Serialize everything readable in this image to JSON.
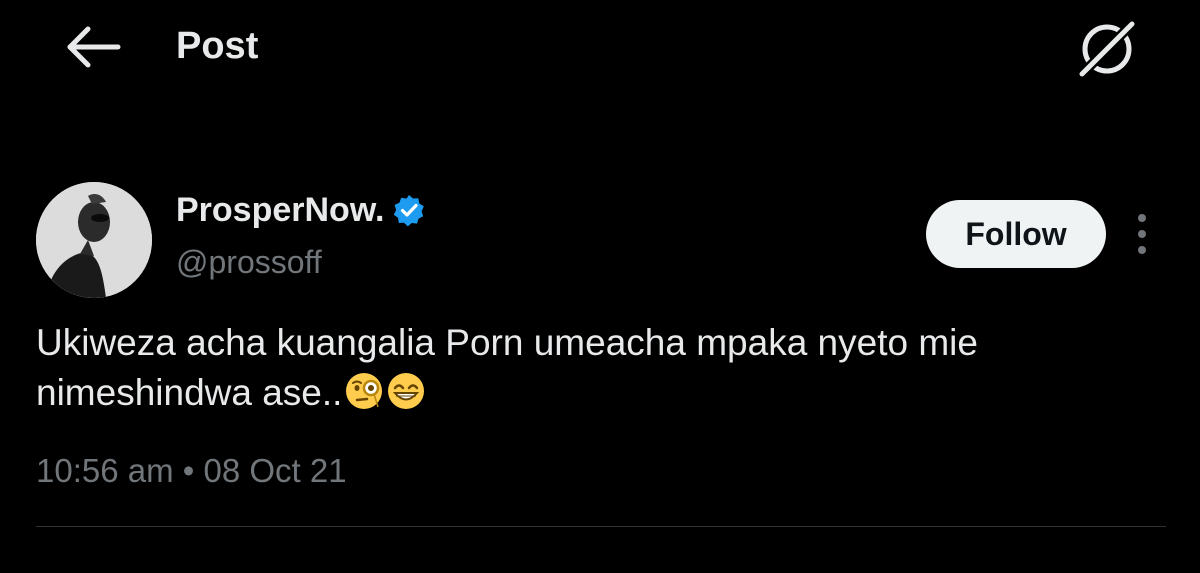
{
  "header": {
    "title": "Post",
    "back_icon": "arrow-left-icon",
    "grok_icon": "grok-slash-icon"
  },
  "post": {
    "author": {
      "name": "ProsperNow.",
      "handle": "@prossoff",
      "verified": true,
      "verified_color": "#1d9bf0"
    },
    "follow_label": "Follow",
    "more_icon": "more-vertical-icon",
    "text": "Ukiweza acha kuangalia Porn umeacha mpaka nyeto mie nimeshindwa ase..",
    "emojis": [
      "face-with-monocle",
      "beaming-face-with-smiling-eyes"
    ],
    "time": "10:56 am",
    "separator": "•",
    "date": "08 Oct 21"
  },
  "colors": {
    "background": "#000000",
    "primary_text": "#e7e9ea",
    "secondary_text": "#71767b",
    "follow_bg": "#eff3f4",
    "divider": "#2f3336"
  }
}
